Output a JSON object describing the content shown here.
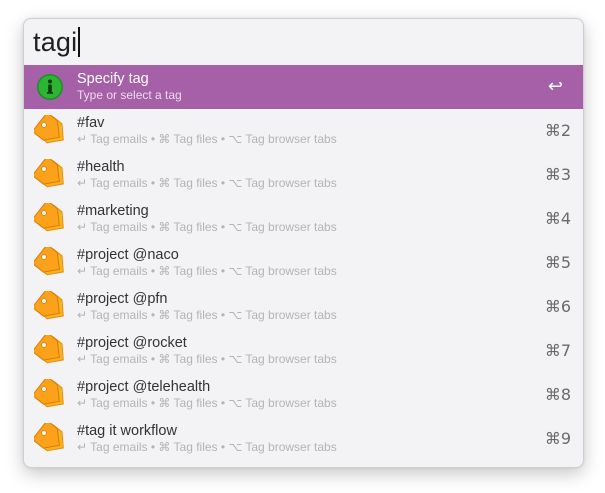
{
  "search": {
    "query": "tagi"
  },
  "selected": {
    "title": "Specify tag",
    "subtitle": "Type or select a tag",
    "shortcut": "↩",
    "icon": "info-icon"
  },
  "results": [
    {
      "title": "#fav",
      "subtitle": "↵ Tag emails • ⌘ Tag files • ⌥ Tag browser tabs",
      "shortcut": "⌘2",
      "icon": "tag-icon"
    },
    {
      "title": "#health",
      "subtitle": "↵ Tag emails • ⌘ Tag files • ⌥ Tag browser tabs",
      "shortcut": "⌘3",
      "icon": "tag-icon"
    },
    {
      "title": "#marketing",
      "subtitle": "↵ Tag emails • ⌘ Tag files • ⌥ Tag browser tabs",
      "shortcut": "⌘4",
      "icon": "tag-icon"
    },
    {
      "title": "#project @naco",
      "subtitle": "↵ Tag emails • ⌘ Tag files • ⌥ Tag browser tabs",
      "shortcut": "⌘5",
      "icon": "tag-icon"
    },
    {
      "title": "#project @pfn",
      "subtitle": "↵ Tag emails • ⌘ Tag files • ⌥ Tag browser tabs",
      "shortcut": "⌘6",
      "icon": "tag-icon"
    },
    {
      "title": "#project @rocket",
      "subtitle": "↵ Tag emails • ⌘ Tag files • ⌥ Tag browser tabs",
      "shortcut": "⌘7",
      "icon": "tag-icon"
    },
    {
      "title": "#project @telehealth",
      "subtitle": "↵ Tag emails • ⌘ Tag files • ⌥ Tag browser tabs",
      "shortcut": "⌘8",
      "icon": "tag-icon"
    },
    {
      "title": "#tag it workflow",
      "subtitle": "↵ Tag emails • ⌘ Tag files • ⌥ Tag browser tabs",
      "shortcut": "⌘9",
      "icon": "tag-icon"
    }
  ],
  "colors": {
    "selection": "#a560a8",
    "tag_orange": "#f7a41d",
    "info_green": "#25a52e"
  }
}
